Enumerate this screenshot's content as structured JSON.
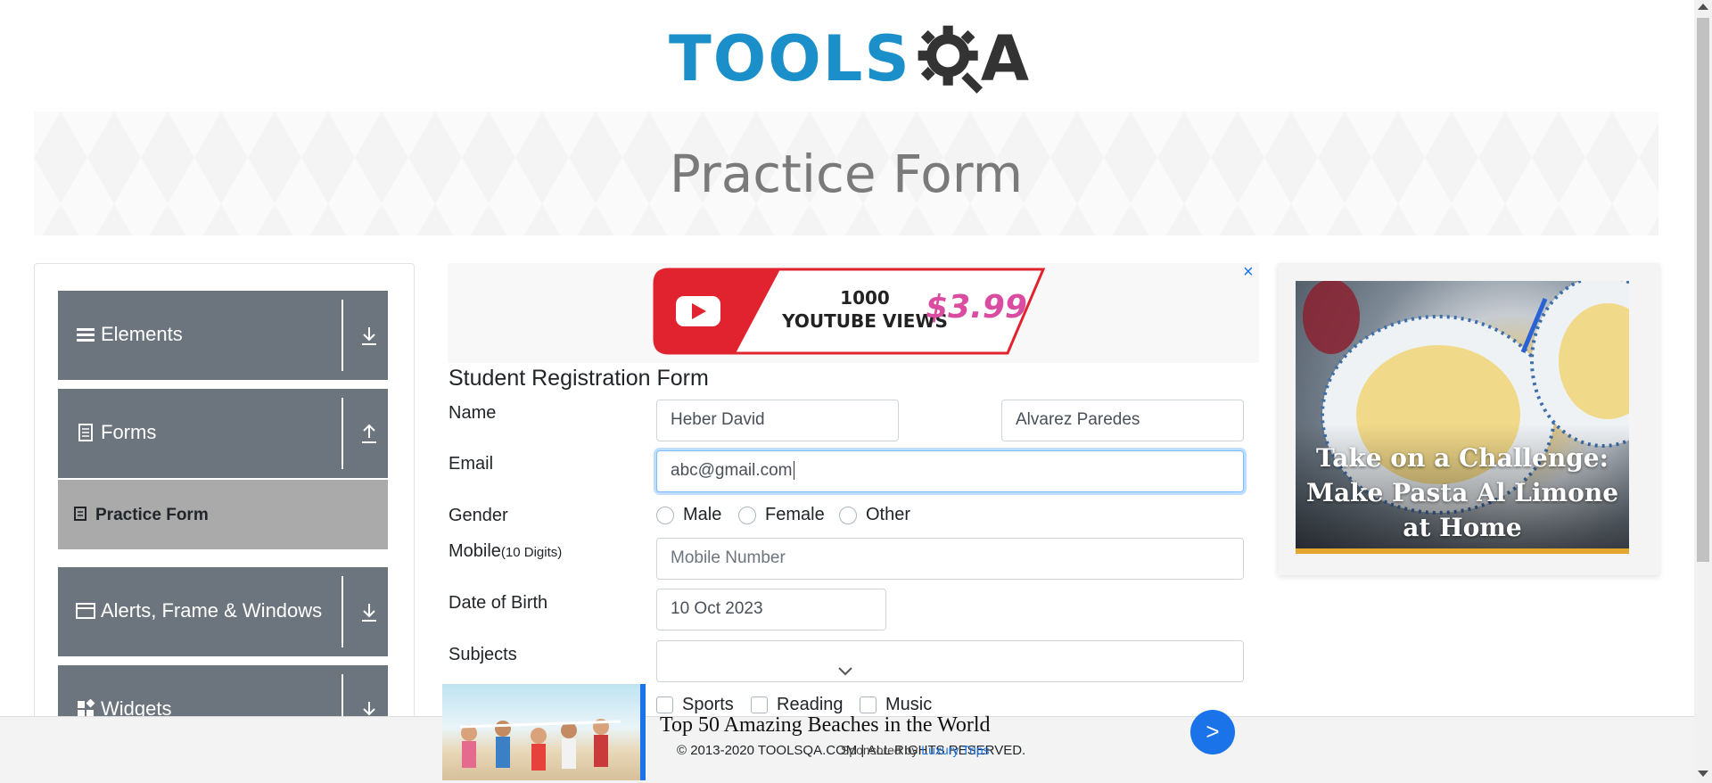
{
  "logo": {
    "tools_text": "TOOLS",
    "a_text": "A",
    "brand_blue": "#1a8fc9",
    "brand_dark": "#333333"
  },
  "banner": {
    "title": "Practice Form"
  },
  "sidebar": {
    "groups": [
      {
        "label": "Elements",
        "icon": "hamburger-icon",
        "arrow": "download-arrow-icon"
      },
      {
        "label": "Forms",
        "icon": "document-icon",
        "arrow": "upload-arrow-icon"
      },
      {
        "label": "Alerts, Frame & Windows",
        "icon": "window-icon",
        "arrow": "download-arrow-icon"
      },
      {
        "label": "Widgets",
        "icon": "widgets-icon",
        "arrow": "download-arrow-icon"
      }
    ],
    "active_item": {
      "label": "Practice Form",
      "icon": "form-doc-icon"
    }
  },
  "ad_top": {
    "line1": "1000",
    "line2": "YOUTUBE VIEWS",
    "price": "$3.99",
    "close": "×"
  },
  "form": {
    "title": "Student Registration Form",
    "name_label": "Name",
    "first_name_value": "Heber David",
    "last_name_value": "Alvarez Paredes",
    "email_label": "Email",
    "email_value": "abc@gmail.com",
    "gender_label": "Gender",
    "gender_options": [
      "Male",
      "Female",
      "Other"
    ],
    "mobile_label": "Mobile",
    "mobile_hint": "(10 Digits)",
    "mobile_placeholder": "Mobile Number",
    "dob_label": "Date of Birth",
    "dob_value": "10 Oct 2023",
    "subjects_label": "Subjects",
    "hobbies": [
      "Sports",
      "Reading",
      "Music"
    ]
  },
  "ad_right": {
    "headline": "Take on a Challenge: Make Pasta Al Limone at Home"
  },
  "ad_bottom": {
    "title": "Top 50 Amazing Beaches in the World",
    "go": ">"
  },
  "footer": {
    "copyright": "© 2013-2020 TOOLSQA.COM | ALL RIGHTS RESERVED.",
    "sponsored_prefix": "Sponsored by",
    "sponsored_name": "Luxury Trips"
  }
}
